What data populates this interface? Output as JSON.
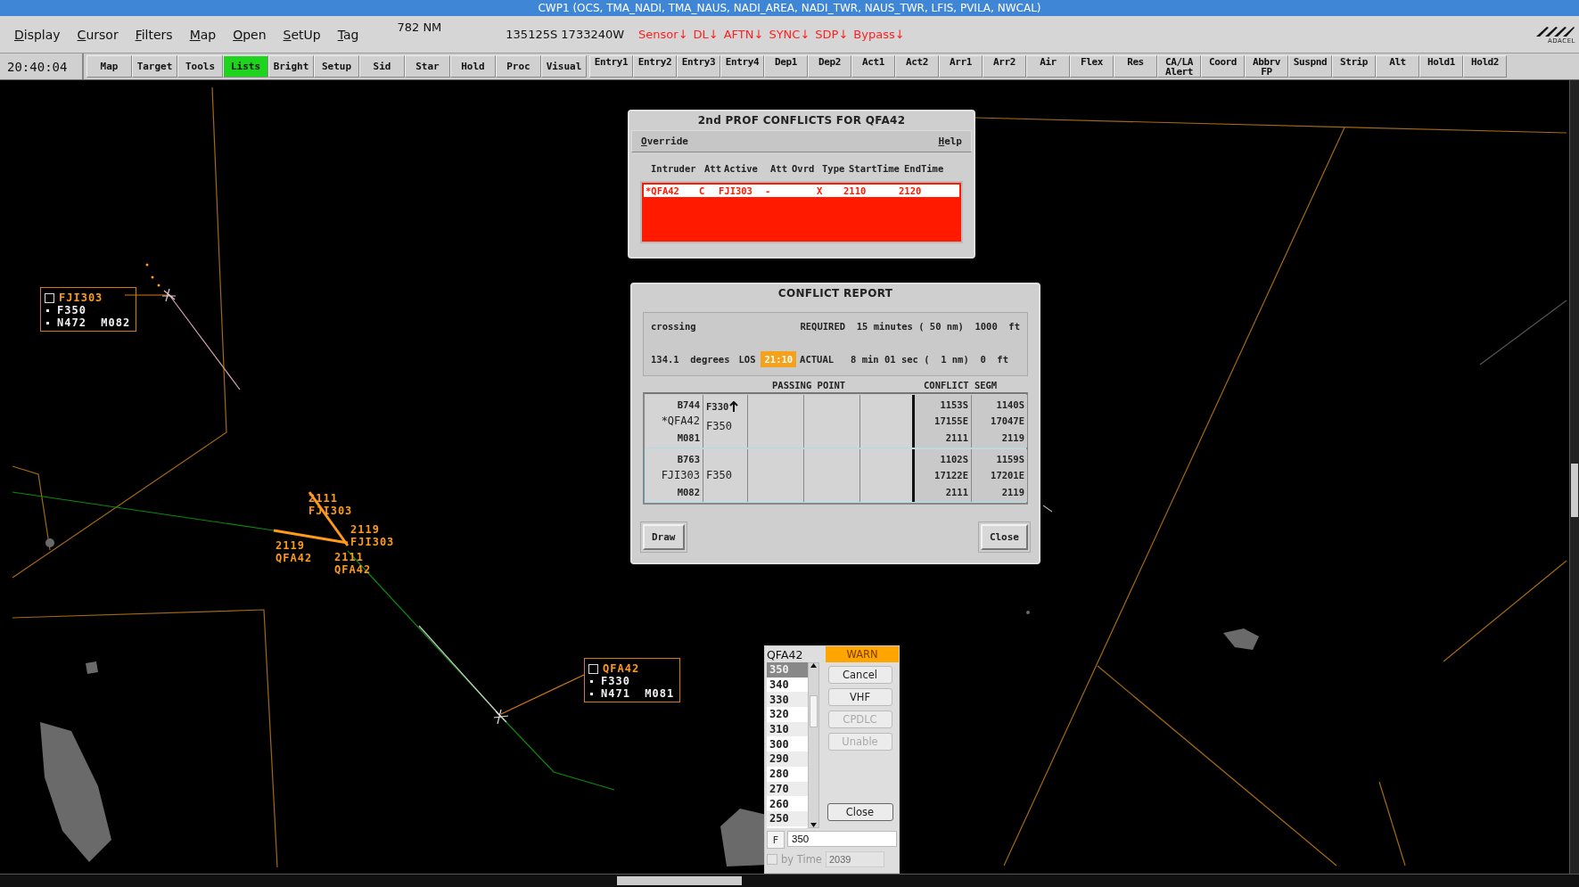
{
  "window": {
    "title": "CWP1 (OCS, TMA_NADI, TMA_NAUS, NADI_AREA, NADI_TWR, NAUS_TWR, LFIS, PVILA, NWCAL)"
  },
  "menu": [
    "Display",
    "Cursor",
    "Filters",
    "Map",
    "Open",
    "SetUp",
    "Tag"
  ],
  "range": "782 NM",
  "position": "135125S 1733240W",
  "status_flags": [
    "Sensor↓",
    "DL↓",
    "AFTN↓",
    "SYNC↓",
    "SDP↓",
    "Bypass↓"
  ],
  "logo": "ADACEL",
  "clock": "20:40:04",
  "toolbar_left": [
    {
      "label": "Map",
      "selected": false
    },
    {
      "label": "Target",
      "selected": false
    },
    {
      "label": "Tools",
      "selected": false
    },
    {
      "label": "Lists",
      "selected": true
    },
    {
      "label": "Bright",
      "selected": false
    },
    {
      "label": "Setup",
      "selected": false
    },
    {
      "label": "Sid",
      "selected": false
    },
    {
      "label": "Star",
      "selected": false
    },
    {
      "label": "Hold",
      "selected": false
    },
    {
      "label": "Proc",
      "selected": false
    },
    {
      "label": "Visual",
      "selected": false
    }
  ],
  "toolbar_right": [
    "Entry1",
    "Entry2",
    "Entry3",
    "Entry4",
    "Dep1",
    "Dep2",
    "Act1",
    "Act2",
    "Arr1",
    "Arr2",
    "Air",
    "Flex",
    "Res",
    "CA/LA\nAlert",
    "Coord",
    "Abbrv FP",
    "Suspnd",
    "Strip",
    "Alt",
    "Hold1",
    "Hold2"
  ],
  "map": {
    "tracks": [
      {
        "selected": false,
        "callsign": "FJI303",
        "level": "F350",
        "info": "N472  M082"
      },
      {
        "selected": false,
        "callsign": "QFA42",
        "level": "F330",
        "info": "N471  M081"
      }
    ],
    "conflict_labels": [
      {
        "time": "2111",
        "callsign": "FJI303"
      },
      {
        "time": "2119",
        "callsign": "FJI303"
      },
      {
        "time": "2119",
        "callsign": "QFA42"
      },
      {
        "time": "2111",
        "callsign": "QFA42"
      }
    ]
  },
  "conflicts_dialog": {
    "title": "2nd PROF CONFLICTS FOR  QFA42",
    "menu": [
      "Override",
      "Help"
    ],
    "columns": [
      "Intruder",
      "Att",
      "Active",
      "Att",
      "Ovrd",
      "Type",
      "StartTime",
      "EndTime"
    ],
    "rows": [
      {
        "selected": true,
        "intruder": "*QFA42",
        "att": "C",
        "active": "FJI303",
        "active_att": "-",
        "type": "X",
        "start_time": "2110",
        "end_time": "2120"
      }
    ]
  },
  "conflict_report": {
    "title": "CONFLICT REPORT",
    "conflict_type": "crossing",
    "required": "REQUIRED  15 minutes ( 50 nm)  1000  ft",
    "angle": "134.1  degrees",
    "los_label": "LOS",
    "los_time": "21:10",
    "actual": "ACTUAL   8 min 01 sec (  1 nm)  0  ft",
    "passing_point_header": "PASSING POINT",
    "segment_header": "CONFLICT SEGM",
    "flights": [
      {
        "selected": false,
        "aircraft_type": "B744",
        "callsign": "*QFA42",
        "speed": "M081",
        "cleared_level": "F330",
        "climbing": true,
        "level": "F350",
        "segments": [
          [
            "1153S",
            "17155E",
            "2111"
          ],
          [
            "1140S",
            "17047E",
            "2119"
          ]
        ]
      },
      {
        "selected": true,
        "aircraft_type": "B763",
        "callsign": "FJI303",
        "speed": "M082",
        "level": "F350",
        "climbing": false,
        "segments": [
          [
            "1102S",
            "17122E",
            "2111"
          ],
          [
            "1159S",
            "17201E",
            "2119"
          ]
        ]
      }
    ],
    "buttons": [
      "Draw",
      "Close"
    ]
  },
  "altitude_picker": {
    "callsign": "QFA42",
    "alert": "WARN",
    "levels": [
      {
        "label": "350",
        "selected": true
      },
      {
        "label": "340",
        "selected": false
      },
      {
        "label": "330",
        "selected": false
      },
      {
        "label": "320",
        "selected": false
      },
      {
        "label": "310",
        "selected": false
      },
      {
        "label": "300",
        "selected": false
      },
      {
        "label": "290",
        "selected": false
      },
      {
        "label": "280",
        "selected": false
      },
      {
        "label": "270",
        "selected": false
      },
      {
        "label": "260",
        "selected": false
      },
      {
        "label": "250",
        "selected": false
      }
    ],
    "buttons": [
      {
        "label": "Cancel",
        "disabled": false
      },
      {
        "label": "VHF",
        "disabled": false
      },
      {
        "label": "CPDLC",
        "disabled": true
      },
      {
        "label": "Unable",
        "disabled": true
      }
    ],
    "close": "Close",
    "prefix": "F",
    "value": "350",
    "by_time": {
      "label": "by Time",
      "checked": false,
      "disabled": true,
      "value": "2039"
    }
  }
}
